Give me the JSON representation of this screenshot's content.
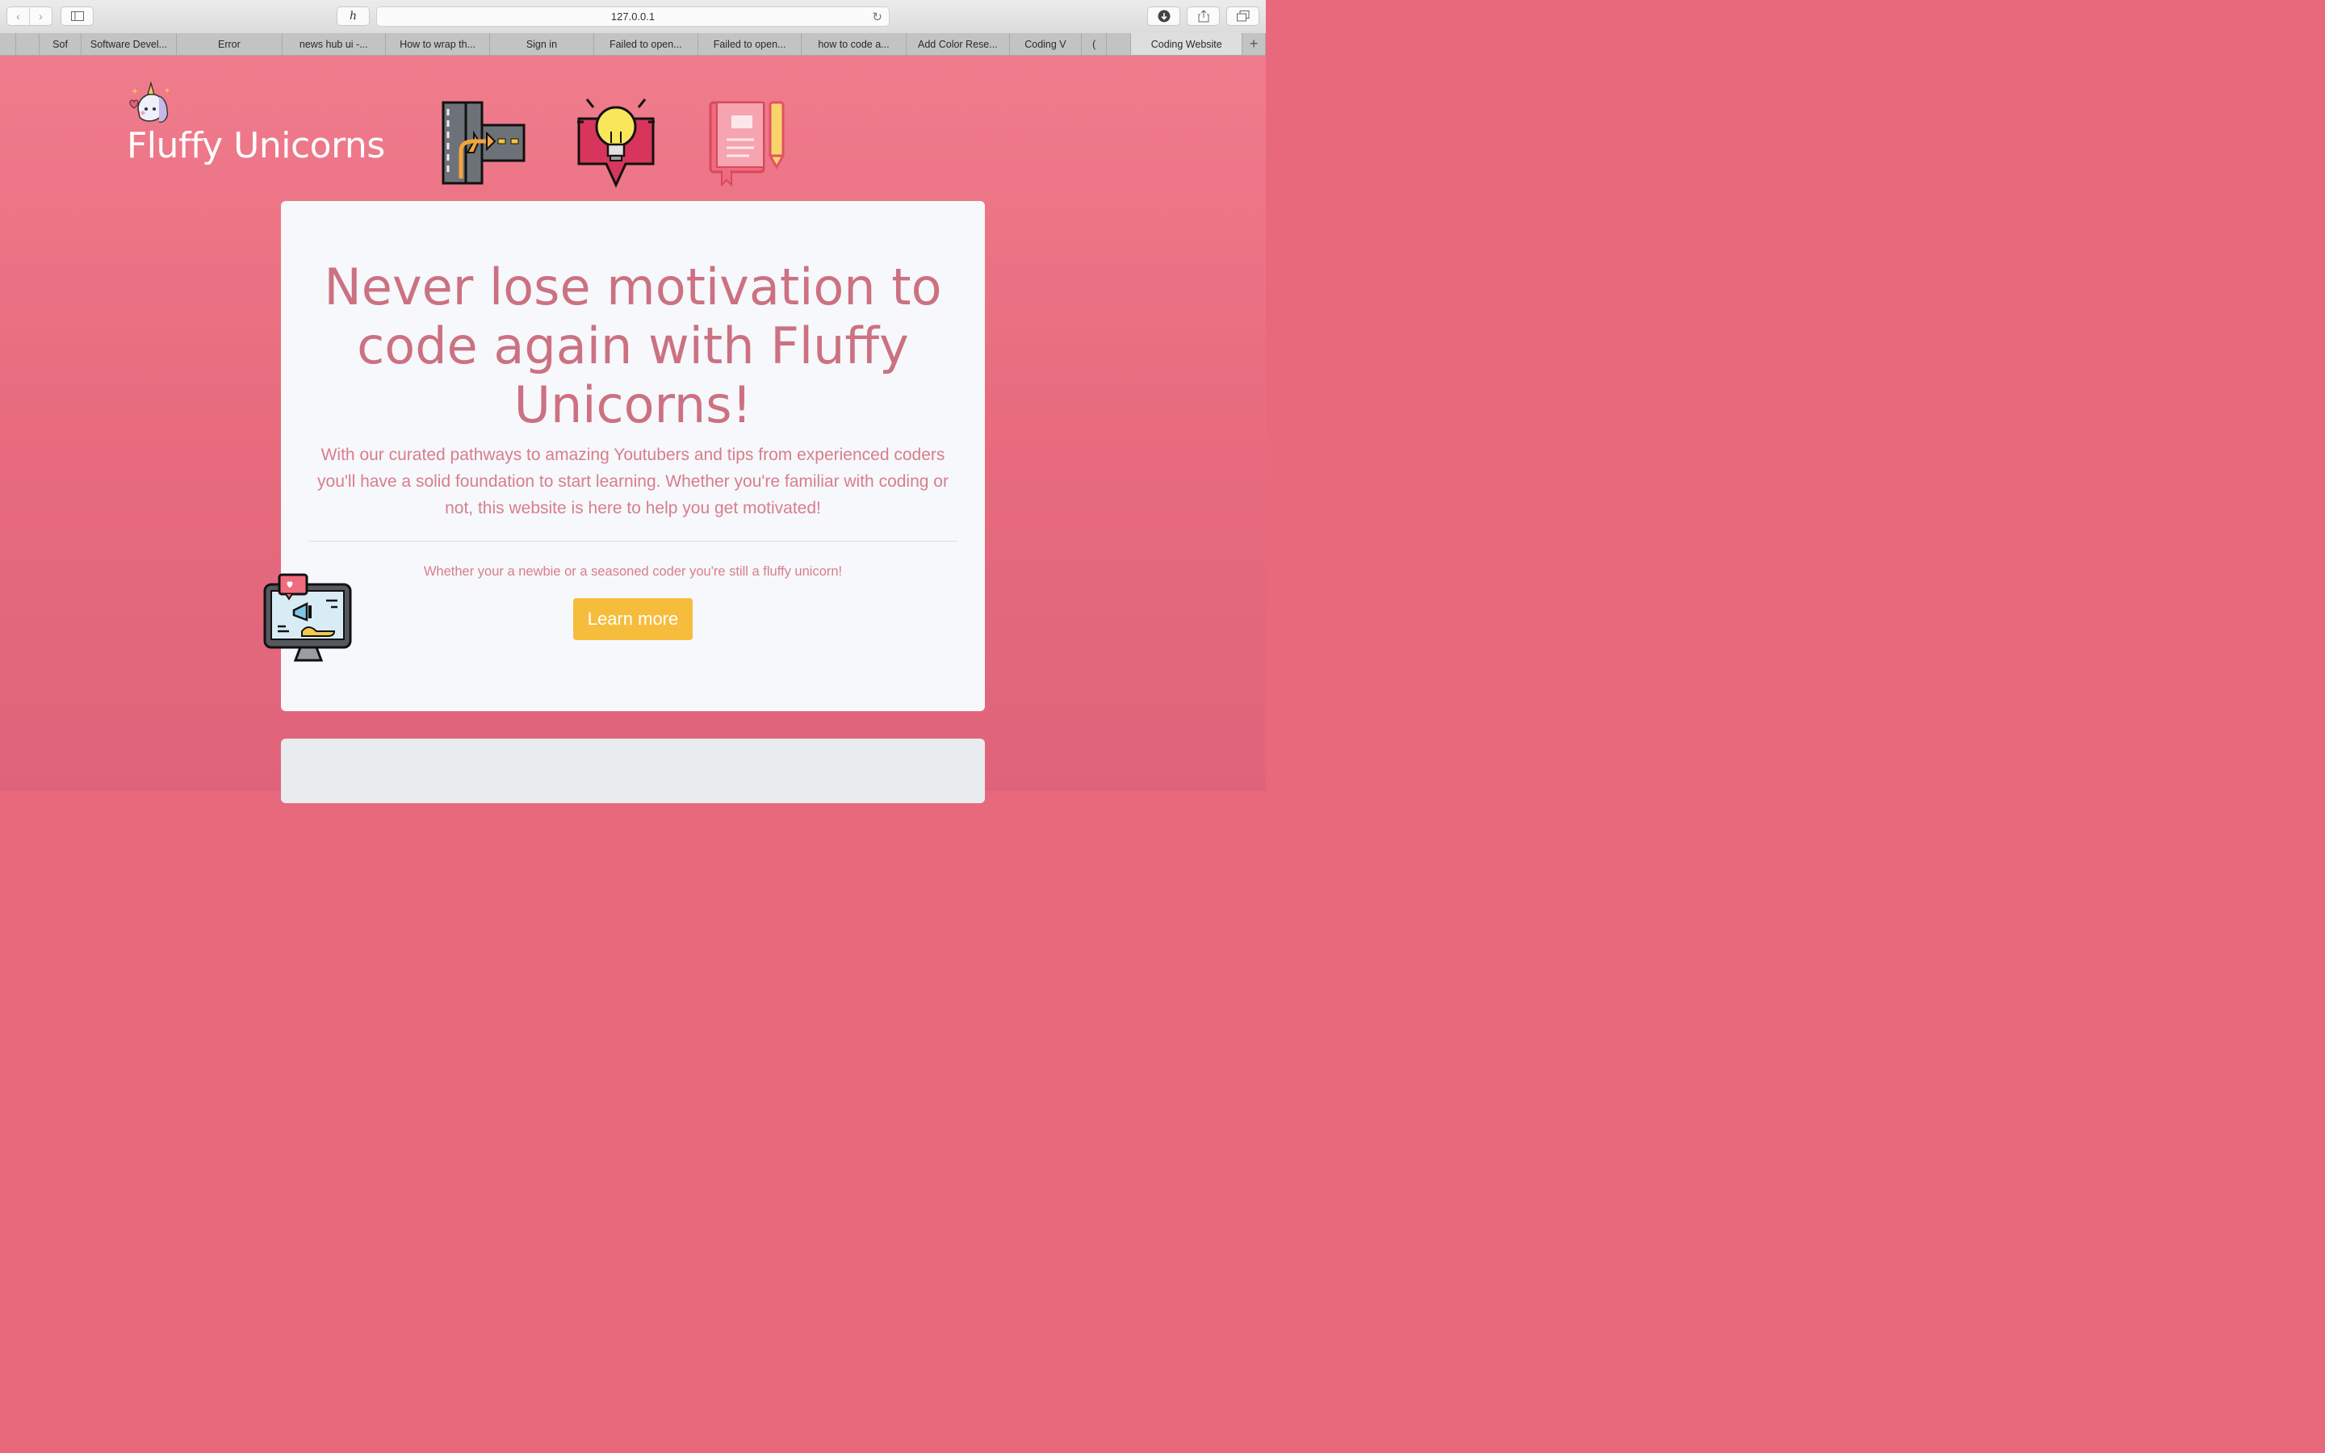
{
  "browser": {
    "url": "127.0.0.1",
    "tabs": [
      {
        "label": "",
        "width": 20
      },
      {
        "label": "",
        "width": 30
      },
      {
        "label": "Sof",
        "width": 52
      },
      {
        "label": "Software Devel...",
        "width": 120
      },
      {
        "label": "Error",
        "width": 132
      },
      {
        "label": "news hub ui -...",
        "width": 130
      },
      {
        "label": "How to wrap th...",
        "width": 131
      },
      {
        "label": "Sign in",
        "width": 130
      },
      {
        "label": "Failed to open...",
        "width": 131
      },
      {
        "label": "Failed to open...",
        "width": 130
      },
      {
        "label": "how to code a...",
        "width": 131
      },
      {
        "label": "Add Color Rese...",
        "width": 130
      },
      {
        "label": "Coding V",
        "width": 90
      },
      {
        "label": "(",
        "width": 32
      },
      {
        "label": "",
        "width": 30
      },
      {
        "label": "Coding Website",
        "width": 140,
        "active": true
      },
      {
        "label": "+",
        "width": 29
      }
    ]
  },
  "header": {
    "brand_title": "Fluffy Unicorns"
  },
  "hero": {
    "title": "Never lose motivation to code again with Fluffy Unicorns!",
    "lead": "With our curated pathways to amazing Youtubers and tips from experienced coders you'll have a solid foundation to start learning. Whether you're familiar with coding or not, this website is here to help you get motivated!",
    "subtext": "Whether your a newbie or a seasoned coder you're still a fluffy unicorn!",
    "cta_label": "Learn more"
  },
  "colors": {
    "page_bg": "#e8687c",
    "hero_text": "#cc7182",
    "cta_bg": "#f6bd3d"
  }
}
